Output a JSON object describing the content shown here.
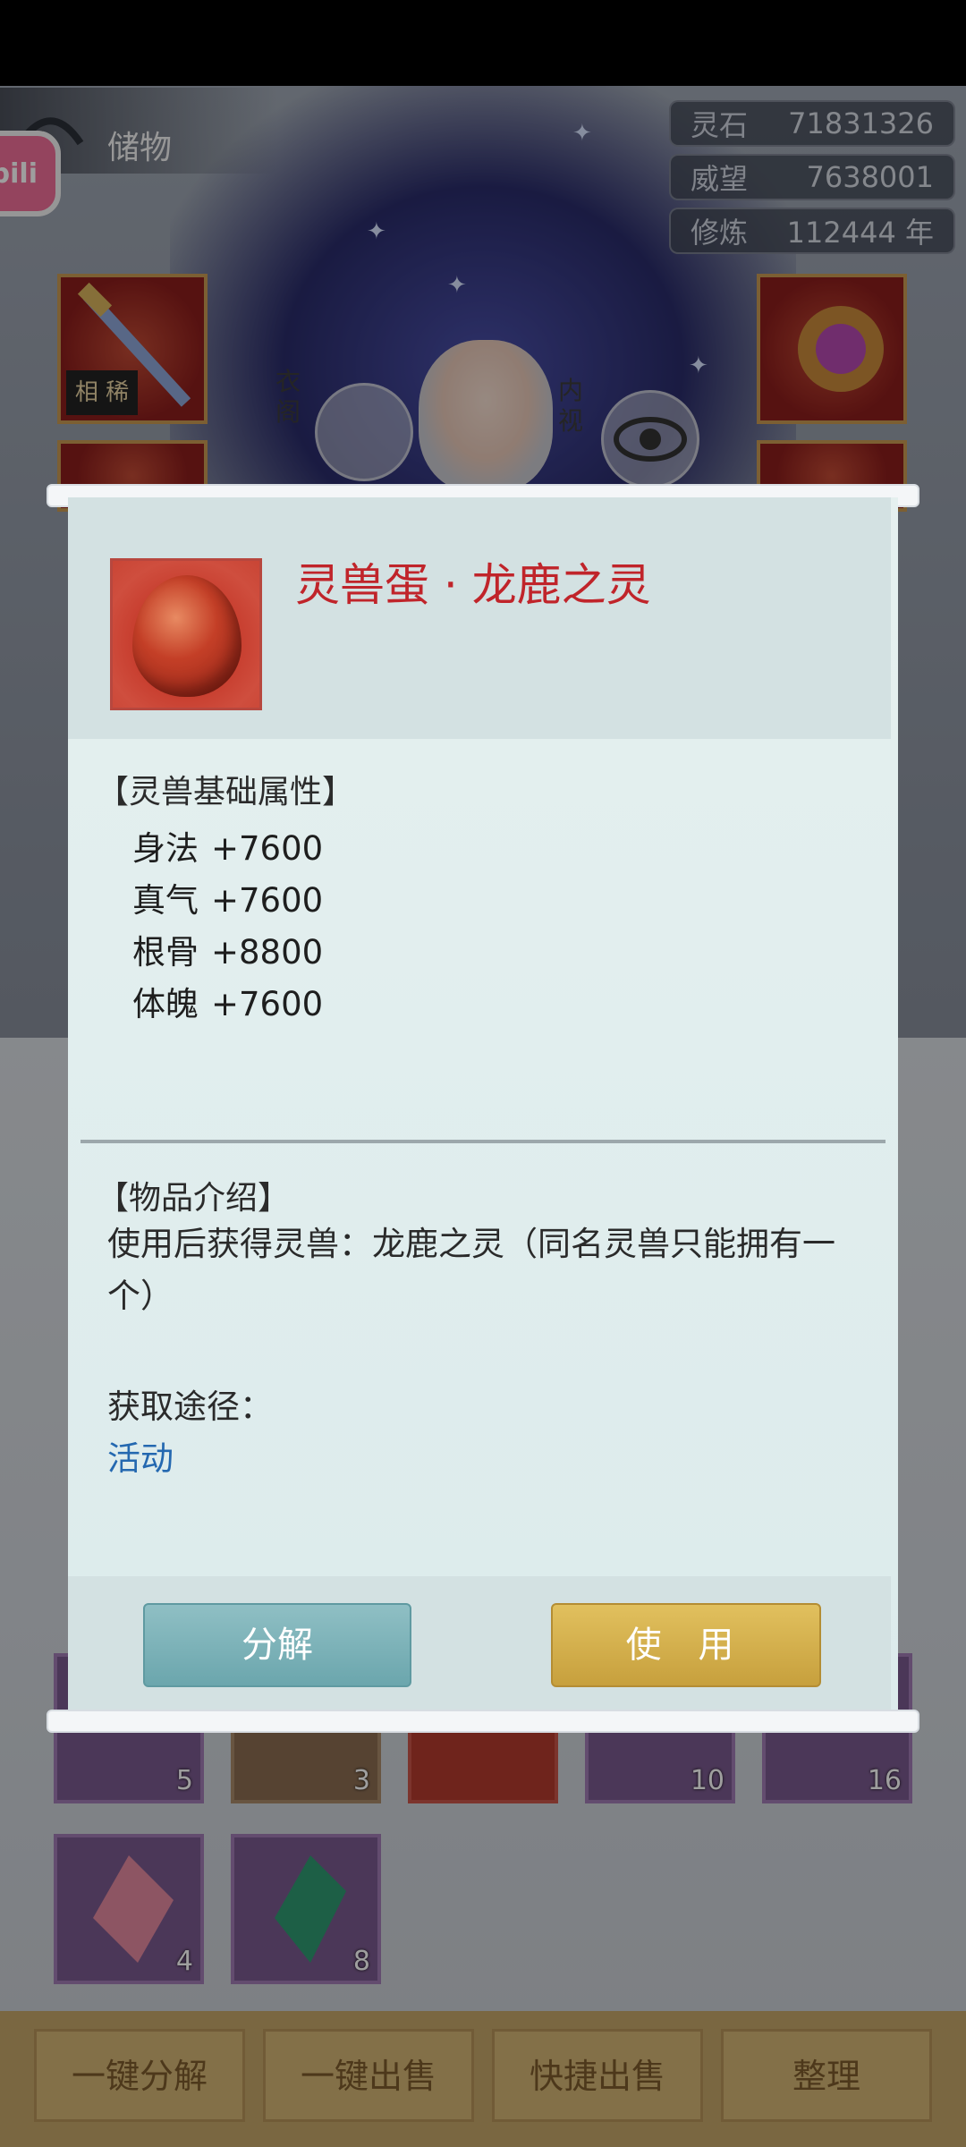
{
  "header": {
    "title": "储物"
  },
  "resources": [
    {
      "label": "灵石",
      "value": "71831326"
    },
    {
      "label": "威望",
      "value": "7638001"
    },
    {
      "label": "修炼",
      "value": "112444 年"
    }
  ],
  "overlay_buttons": {
    "wardrobe": "衣阁",
    "inner_view": "内视"
  },
  "equipment_tags": {
    "weapon": "相 稀"
  },
  "inventory_counts": [
    "5",
    "3",
    "10",
    "16",
    "4",
    "8"
  ],
  "bottom_buttons": [
    "一键分解",
    "一键出售",
    "快捷出售",
    "整理"
  ],
  "item": {
    "name": "灵兽蛋 · 龙鹿之灵",
    "attr_section_title": "【灵兽基础属性】",
    "attributes": [
      {
        "name": "身法",
        "value": "+7600"
      },
      {
        "name": "真气",
        "value": "+7600"
      },
      {
        "name": "根骨",
        "value": "+8800"
      },
      {
        "name": "体魄",
        "value": "+7600"
      }
    ],
    "intro_title": "【物品介绍】",
    "description": "使用后获得灵兽：龙鹿之灵（同名灵兽只能拥有一个）",
    "source_label": "获取途径：",
    "source_link": "活动"
  },
  "actions": {
    "decompose": "分解",
    "use": "使 用"
  },
  "colors": {
    "item_name": "#c0242a",
    "link": "#2468b0",
    "use_button": "#d4b14d",
    "decompose_button": "#7db2b8"
  }
}
